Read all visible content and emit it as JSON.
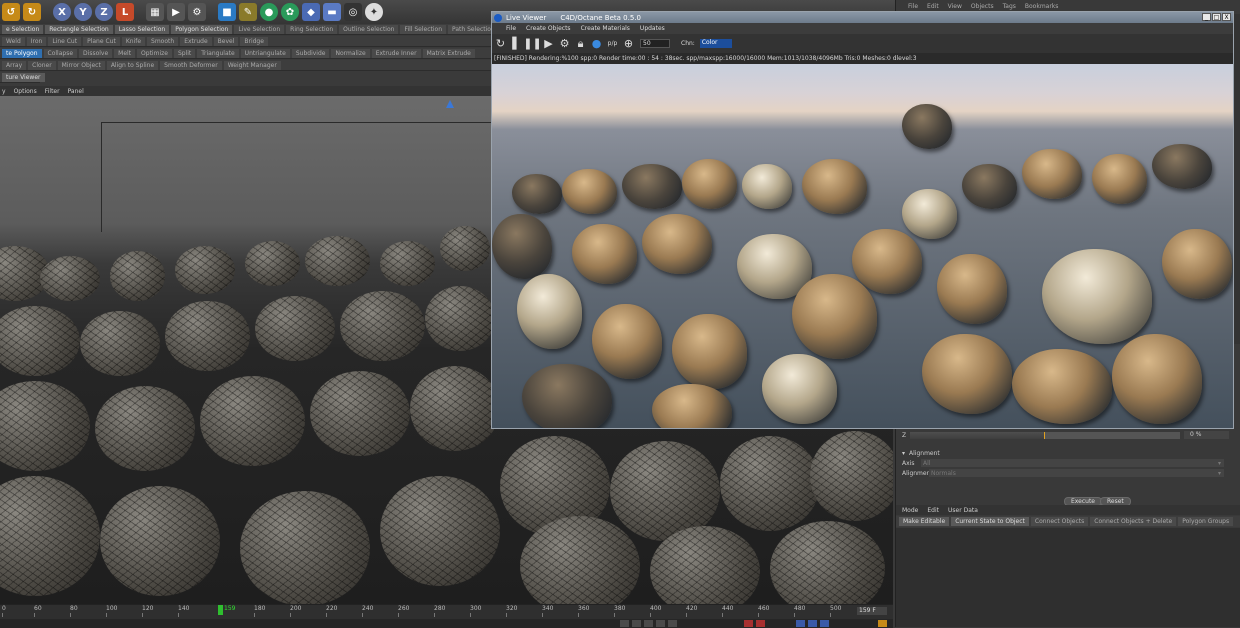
{
  "toolbar": {
    "icons": [
      "undo-icon",
      "redo-icon",
      "x-axis-lock",
      "y-axis-lock",
      "z-axis-lock",
      "world-coords",
      "render-region",
      "render-view",
      "render-settings",
      "cube-primitive",
      "spline-pen",
      "nurbs",
      "deformer",
      "scene-floor",
      "camera",
      "light"
    ],
    "axis_labels": [
      "X",
      "Y",
      "Z"
    ]
  },
  "commands_row1": [
    "e Selection",
    "Rectangle Selection",
    "Lasso Selection",
    "Polygon Selection",
    "Live Selection",
    "Ring Selection",
    "Outline Selection",
    "Fill Selection",
    "Path Selection"
  ],
  "commands_row2": [
    "Weld",
    "Iron",
    "Line Cut",
    "Plane Cut",
    "Knife",
    "Smooth",
    "Extrude",
    "Bevel",
    "Bridge"
  ],
  "commands_row3": [
    "te Polygon",
    "Collapse",
    "Dissolve",
    "Melt",
    "Optimize",
    "Split",
    "Triangulate",
    "Untriangulate",
    "Subdivide",
    "Normalize",
    "Extrude Inner",
    "Matrix Extrude"
  ],
  "commands_row4": [
    "Array",
    "Cloner",
    "Mirror Object",
    "Align to Spline",
    "Smooth Deformer",
    "Weight Manager"
  ],
  "commands_row5": [
    "ture Viewer"
  ],
  "viewport_menu": [
    "y",
    "Options",
    "Filter",
    "Panel"
  ],
  "timeline": {
    "ticks": [
      "0",
      "60",
      "80",
      "100",
      "120",
      "140",
      "160",
      "180",
      "200",
      "220",
      "240",
      "260",
      "280",
      "300",
      "320",
      "340",
      "360",
      "380",
      "400",
      "420",
      "440",
      "460",
      "480",
      "500"
    ],
    "current_frame": "159",
    "frame_field": "159 F"
  },
  "right_panel": {
    "menu": [
      "File",
      "Edit",
      "View",
      "Objects",
      "Tags",
      "Bookmarks"
    ],
    "z_label": "Z",
    "z_value": "0 %",
    "z_progress": 0.5,
    "alignment_header": "Alignment",
    "axis_label": "Axis",
    "axis_value": "All",
    "alignment_label": "Alignment",
    "alignment_value": "Normals",
    "execute_button": "Execute",
    "reset_button": "Reset",
    "bottom_menu": [
      "Mode",
      "Edit",
      "User Data"
    ],
    "bottom_commands": [
      "Make Editable",
      "Current State to Object",
      "Connect Objects",
      "Connect Objects + Delete",
      "Polygon Groups"
    ]
  },
  "live_viewer": {
    "title": "Live Viewer",
    "subtitle": "C4D/Octane Beta 0.5.0",
    "menu": [
      "File",
      "Create Objects",
      "Create Materials",
      "Updates"
    ],
    "spp_value": "50",
    "chn_label": "Chn:",
    "chn_value": "Color",
    "status": "[FINISHED]  Rendering:%100 spp:0 Render time:00 : 54 : 38sec. spp/maxspp:16000/16000 Mem:1013/1038/4096Mb Tris:0 Meshes:0 dlevel:3",
    "window_buttons": [
      "_",
      "□",
      "X"
    ]
  }
}
